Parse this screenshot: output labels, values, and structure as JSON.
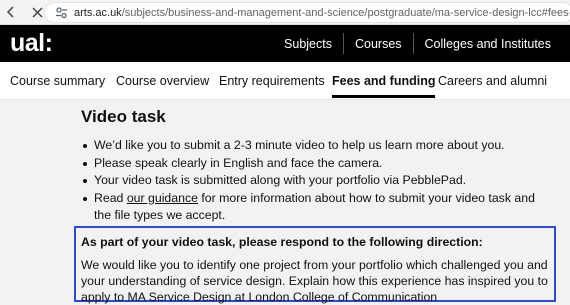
{
  "browser": {
    "url_host": "arts.ac.uk",
    "url_path": "/subjects/business-and-management-and-science/postgraduate/ma-service-design-lcc#fees-and-funding"
  },
  "header": {
    "logo": "ual:",
    "nav": [
      "Subjects",
      "Courses",
      "Colleges and Institutes"
    ]
  },
  "tabs": [
    {
      "label": "Course summary"
    },
    {
      "label": "Course overview"
    },
    {
      "label": "Entry requirements"
    },
    {
      "label": "Fees and funding",
      "active": true
    },
    {
      "label": "Careers and alumni"
    }
  ],
  "main": {
    "title": "Video task",
    "bullets": [
      "We’d like you to submit a 2-3 minute video to help us learn more about you.",
      "Please speak clearly in English and face the camera.",
      "Your video task is submitted along with your portfolio via PebblePad."
    ],
    "bullet4": {
      "prefix": "Read ",
      "link": "our guidance",
      "suffix": " for more information about how to submit your video task and the file types we accept."
    },
    "callout": {
      "heading": "As part of your video task, please respond to the following direction:",
      "body": "We would like you to identify one project from your portfolio which challenged you and your understanding of service design. Explain how this experience has inspired you to apply to MA Service Design at London College of Communication"
    }
  },
  "colors": {
    "header_bg": "#000000",
    "callout_border": "#2a4bd7",
    "page_bg": "#f2f2f2"
  }
}
